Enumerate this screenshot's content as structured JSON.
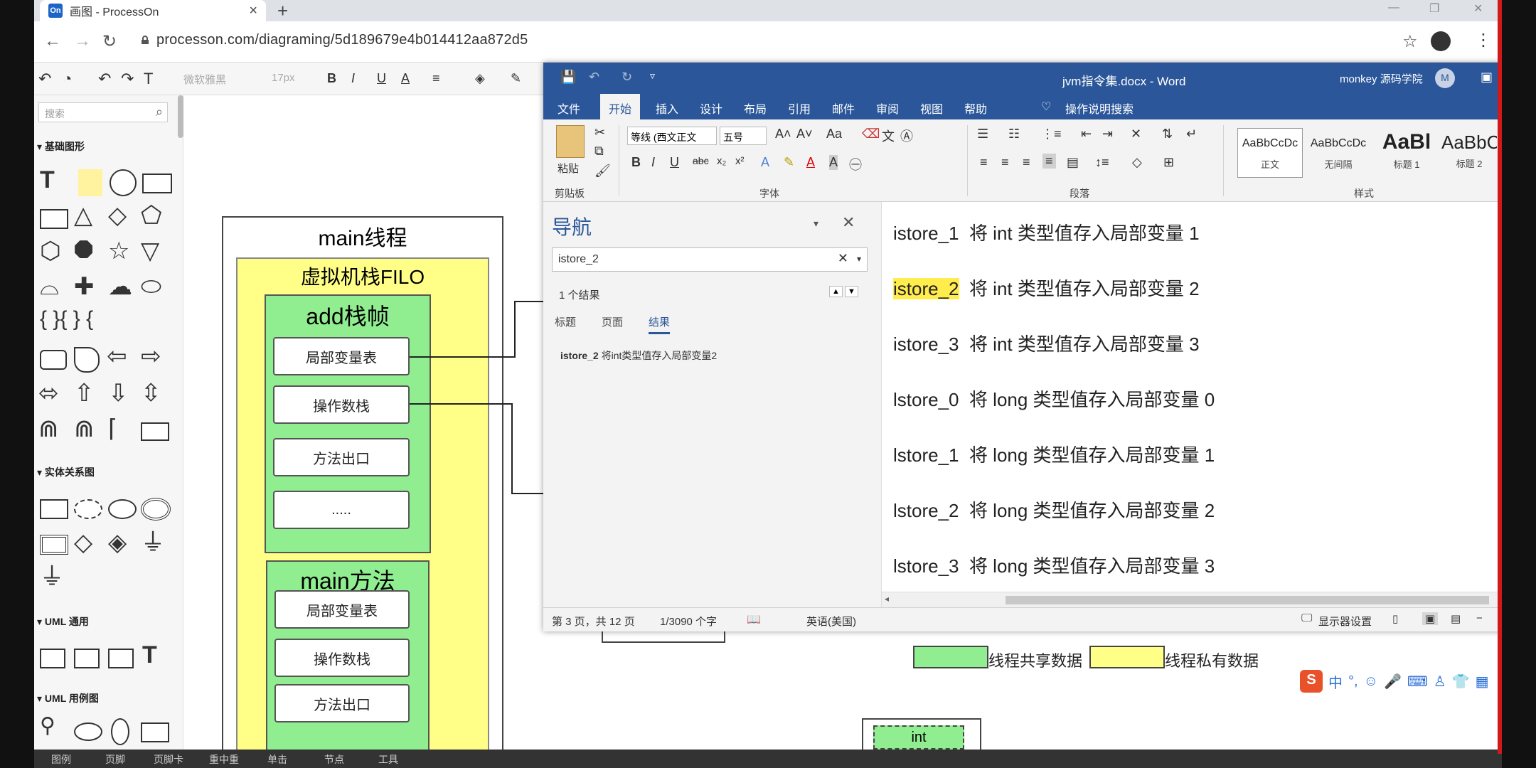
{
  "browser": {
    "tab_title": "画图 - ProcessOn",
    "favicon_text": "On",
    "url": "processon.com/diagraming/5d189679e4b014412aa872d5"
  },
  "toolbar": {
    "font_name": "微软雅黑",
    "font_size": "17px",
    "bold": "B",
    "italic": "I",
    "underline": "U",
    "font_color": "A"
  },
  "left_panel": {
    "search_placeholder": "搜索",
    "sections": {
      "basic": "基础图形",
      "er": "实体关系图",
      "uml_general": "UML 通用",
      "uml_usecase": "UML 用例图"
    }
  },
  "canvas": {
    "main_thread": "main线程",
    "jvm_stack": "虚拟机栈FILO",
    "add_frame": "add栈帧",
    "add_items": [
      "局部变量表",
      "操作数栈",
      "方法出口",
      "....."
    ],
    "main_method": "main方法",
    "main_items": [
      "局部变量表",
      "操作数栈",
      "方法出口"
    ],
    "legend_shared": "线程共享数据",
    "legend_private": "线程私有数据",
    "int_box": "int"
  },
  "word": {
    "title": "jvm指令集.docx - Word",
    "user": "monkey 源码学院",
    "user_initial": "M",
    "tabs": [
      "文件",
      "开始",
      "插入",
      "设计",
      "布局",
      "引用",
      "邮件",
      "审阅",
      "视图",
      "帮助"
    ],
    "tell_me": "操作说明搜索",
    "ribbon": {
      "paste": "粘贴",
      "clipboard": "剪贴板",
      "font_name": "等线 (西文正文",
      "font_size": "五号",
      "font_group": "字体",
      "paragraph_group": "段落",
      "styles_group": "样式",
      "styles": [
        {
          "preview": "AaBbCcDc",
          "name": "正文"
        },
        {
          "preview": "AaBbCcDc",
          "name": "无间隔"
        },
        {
          "preview": "AaBl",
          "name": "标题 1"
        },
        {
          "preview": "AaBbC",
          "name": "标题 2"
        }
      ]
    },
    "nav": {
      "title": "导航",
      "search_value": "istore_2",
      "result_count": "1 个结果",
      "tabs": [
        "标题",
        "页面",
        "结果"
      ],
      "result_bold": "istore_2",
      "result_rest": " 将int类型值存入局部变量2"
    },
    "doc_lines": [
      {
        "cmd": "istore_1",
        "text": "将 int 类型值存入局部变量 1"
      },
      {
        "cmd": "istore_2",
        "text": "将 int 类型值存入局部变量 2"
      },
      {
        "cmd": "istore_3",
        "text": "将 int 类型值存入局部变量 3"
      },
      {
        "cmd": "lstore_0",
        "text": "将 long 类型值存入局部变量 0"
      },
      {
        "cmd": "lstore_1",
        "text": "将 long 类型值存入局部变量 1"
      },
      {
        "cmd": "lstore_2",
        "text": "将 long 类型值存入局部变量 2"
      },
      {
        "cmd": "lstore_3",
        "text": "将 long 类型值存入局部变量 3"
      }
    ],
    "status": {
      "page": "第 3 页，共 12 页",
      "words": "1/3090 个字",
      "lang": "英语(美国)",
      "display": "显示器设置"
    }
  },
  "taskbar": {
    "items": [
      "图例",
      "页脚",
      "页脚卡",
      "重中重",
      "单击",
      "节点",
      "工具"
    ]
  },
  "colors": {
    "word_blue": "#2b579a",
    "shared_green": "#90ee90",
    "private_yellow": "#ffff88",
    "search_highlight": "#ffec4d"
  }
}
